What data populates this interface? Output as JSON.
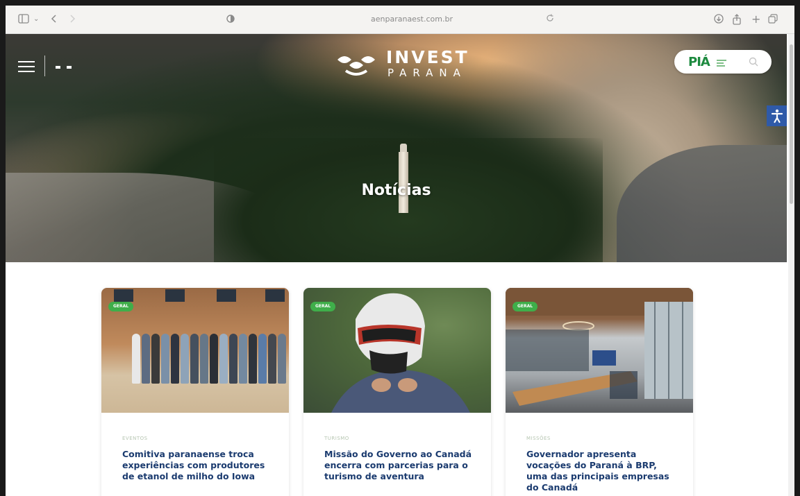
{
  "browser": {
    "url": "aenparanaest.com.br",
    "icons": [
      "sidebar-icon",
      "back-icon",
      "forward-icon",
      "shield-icon",
      "reload-icon",
      "download-icon",
      "share-icon",
      "new-tab-icon",
      "tabs-icon"
    ]
  },
  "header": {
    "logo_word": "INVEST",
    "logo_sub": "PARANA",
    "pia_label": "PIÁ",
    "accessibility_label": "Acessibilidade"
  },
  "hero": {
    "title": "Notícias"
  },
  "cards": [
    {
      "badge": "GERAL",
      "category": "EVENTOS",
      "title": "Comitiva paranaense troca experiências com produtores de etanol de milho do Iowa"
    },
    {
      "badge": "GERAL",
      "category": "TURISMO",
      "title": "Missão do Governo ao Canadá encerra com parcerias para o turismo de aventura"
    },
    {
      "badge": "GERAL",
      "category": "MISSÕES",
      "title": "Governador apresenta vocações do Paraná à BRP, uma das principais empresas do Canadá"
    }
  ],
  "colors": {
    "title_blue": "#1b3b6f",
    "badge_green": "#3fae4a",
    "pia_green": "#1d8a3f",
    "accessibility_blue": "#2f5aa8"
  }
}
